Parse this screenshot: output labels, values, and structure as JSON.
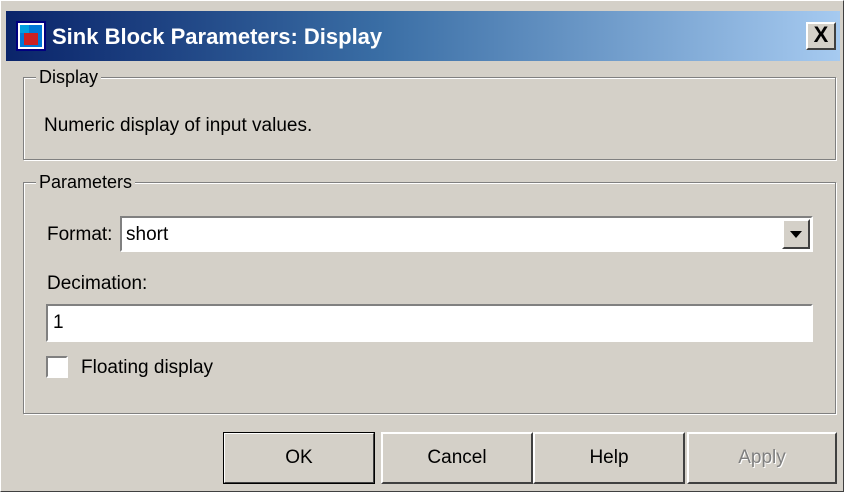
{
  "window": {
    "title": "Sink Block Parameters: Display",
    "close_label": "X"
  },
  "display_group": {
    "legend": "Display",
    "description": "Numeric display of input values."
  },
  "parameters_group": {
    "legend": "Parameters",
    "format_label": "Format:",
    "format_value": "short",
    "decimation_label": "Decimation:",
    "decimation_value": "1",
    "floating_display_label": "Floating display",
    "floating_display_checked": false
  },
  "buttons": {
    "ok": "OK",
    "cancel": "Cancel",
    "help": "Help",
    "apply": "Apply"
  },
  "icons": {
    "app": "simulink-block-icon",
    "dropdown": "chevron-down-icon"
  },
  "colors": {
    "titlebar_start": "#0a246a",
    "titlebar_end": "#a6caf0",
    "dialog_face": "#d4d0c8"
  }
}
